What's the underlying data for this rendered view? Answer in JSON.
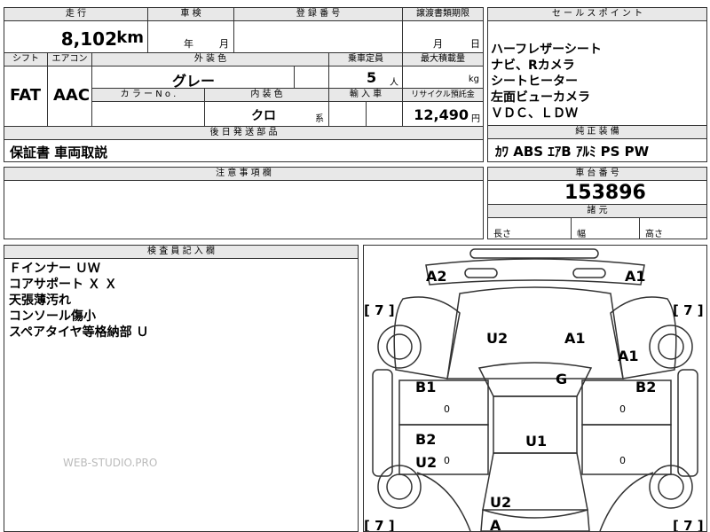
{
  "top": {
    "mileage_label": "走 行",
    "mileage_value": "8,102",
    "mileage_unit": "km",
    "inspection_label": "車 検",
    "year_unit": "年",
    "month_unit": "月",
    "registration_label": "登 録 番 号",
    "transfer_label": "譲渡書類期限",
    "transfer_month_unit": "月",
    "transfer_day_unit": "日",
    "shift_label": "シフト",
    "shift_value": "FAT",
    "aircon_label": "エアコン",
    "aircon_value": "AAC",
    "exterior_color_label": "外 装 色",
    "exterior_color_value": "グレー",
    "capacity_label": "乗車定員",
    "capacity_value": "5",
    "capacity_unit": "人",
    "max_load_label": "最大積載量",
    "max_load_unit": "kg",
    "color_no_label": "カ ラ ー N o .",
    "interior_color_label": "内 装 色",
    "interior_color_value": "クロ",
    "interior_color_suffix": "系",
    "import_label": "輸 入 車",
    "recycle_label": "リサイクル預託金",
    "recycle_value": "12,490",
    "recycle_unit": "円",
    "later_parts_label": "後 日 発 送 部 品",
    "later_parts_value": "保証書 車両取説",
    "notes_label": "注 意 事 項 欄",
    "inspector_label": "検 査 員 記 入 欄"
  },
  "sales": {
    "label": "セ ー ル ス ポ イ ン ト",
    "lines": [
      "ハーフレザーシート",
      "ナビ、Rカメラ",
      "シートヒーター",
      "左面ビューカメラ",
      "ＶＤＣ、ＬＤＷ"
    ]
  },
  "equipment": {
    "label": "純 正 装 備",
    "value": "ｶﾜ ABS ｴｱB ｱﾙﾐ PS PW"
  },
  "chassis": {
    "label": "車 台 番 号",
    "value": "153896"
  },
  "dimensions": {
    "label": "諸 元",
    "length_label": "長さ",
    "width_label": "幅",
    "height_label": "高さ"
  },
  "inspector_notes": [
    "Ｆインナー ＵＷ",
    "コアサポート Ｘ Ｘ",
    "天張薄汚れ",
    "コンソール傷小",
    "スペアタイヤ等格納部 Ｕ"
  ],
  "watermark": "WEB-STUDIO.PRO",
  "diagram": {
    "marks": {
      "a2_top": "A2",
      "a1_top": "A1",
      "u2_front": "U2",
      "a1_hood": "A1",
      "a1_right": "A1",
      "b1_left": "B1",
      "g_roof": "G",
      "b2_right": "B2",
      "b2_left": "B2",
      "u1_roof": "U1",
      "u2_left": "U2",
      "u2_rear": "U2",
      "a_bottom": "A"
    },
    "tire_left_top": "[ 7 ]",
    "tire_right_top": "[ 7 ]",
    "tire_left_bottom": "[ 7 ]",
    "tire_right_bottom": "[ 7 ]",
    "zero": "0"
  }
}
